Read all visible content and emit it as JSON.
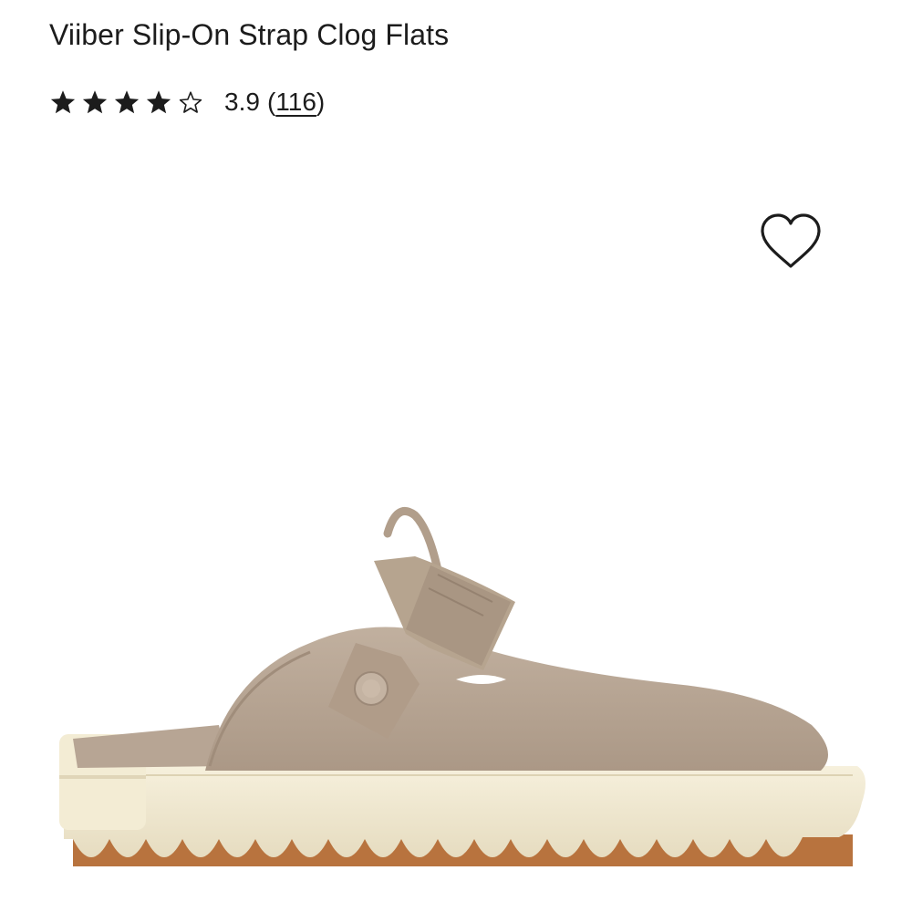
{
  "product": {
    "title": "Viiber Slip-On Strap Clog Flats",
    "rating": {
      "stars_filled": 4,
      "stars_total": 5,
      "value": "3.9",
      "open_paren": "(",
      "count": "116",
      "close_paren": ")"
    }
  },
  "icons": {
    "wishlist": "heart-outline-icon",
    "star_filled": "star-filled-icon",
    "star_empty": "star-outline-icon"
  },
  "colors": {
    "text": "#1c1c1c",
    "suede": "#b5a392",
    "sole": "#f1ead2",
    "tread": "#b8733e"
  }
}
